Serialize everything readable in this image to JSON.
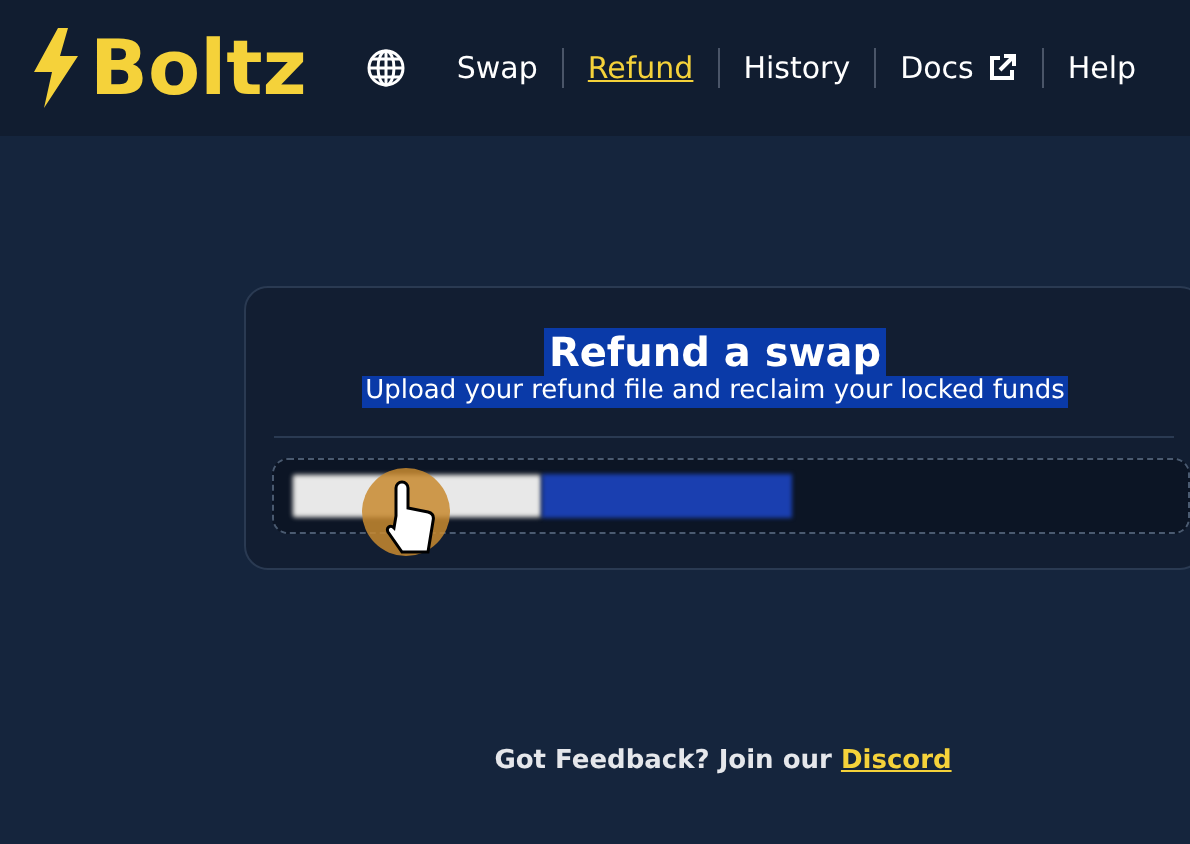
{
  "header": {
    "logo": "Boltz",
    "nav": [
      {
        "label": "Swap",
        "selected": false,
        "external": false
      },
      {
        "label": "Refund",
        "selected": true,
        "external": false
      },
      {
        "label": "History",
        "selected": false,
        "external": false
      },
      {
        "label": "Docs",
        "selected": false,
        "external": true
      },
      {
        "label": "Help",
        "selected": false,
        "external": false
      }
    ]
  },
  "card": {
    "title": "Refund a swap",
    "subtitle": "Upload your refund file and reclaim your locked funds",
    "text_selected": true
  },
  "footer": {
    "text": "Got Feedback? Join our",
    "link": "Discord"
  }
}
